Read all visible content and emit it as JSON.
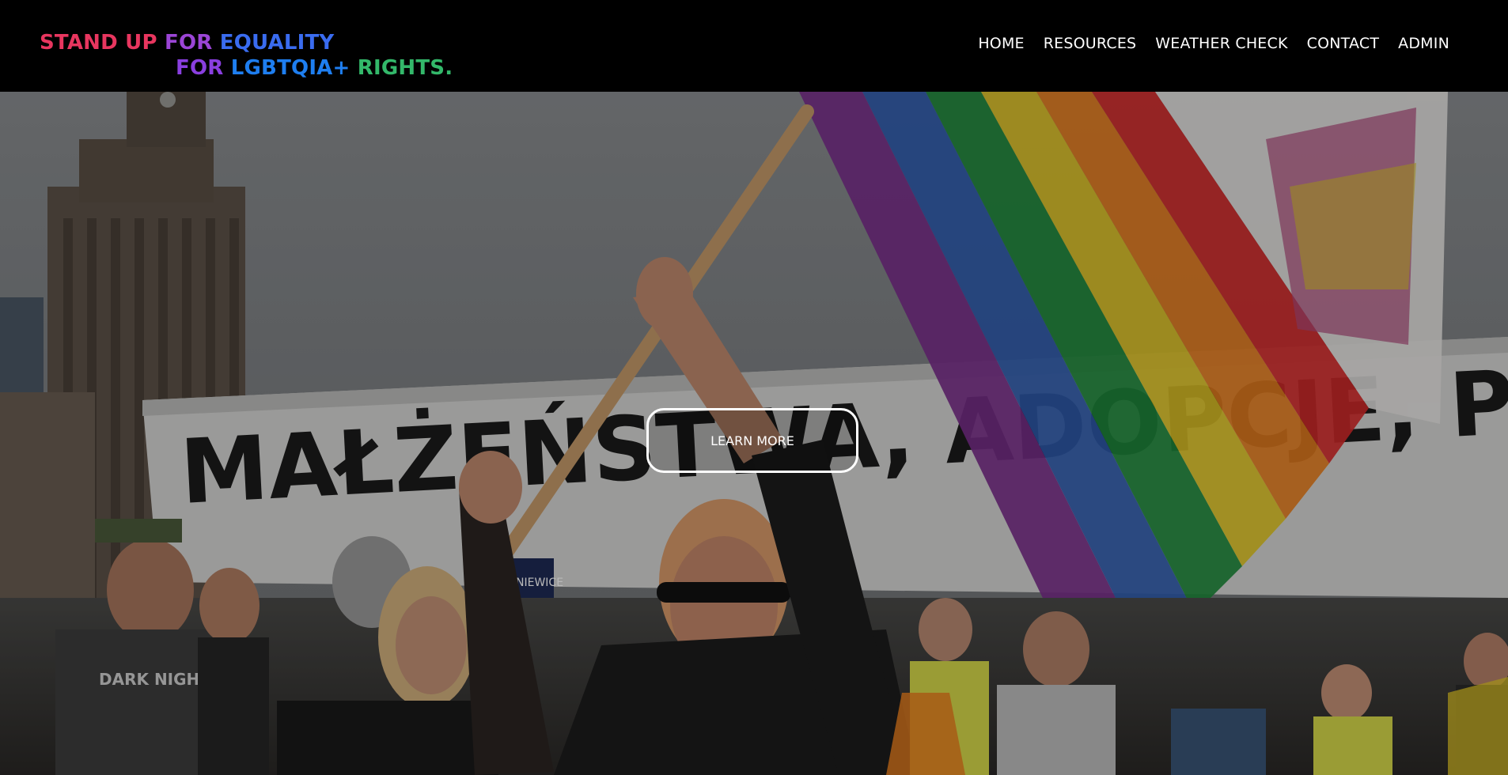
{
  "header": {
    "logo": {
      "line1": [
        {
          "text": "STAND UP ",
          "color": "#e8365f"
        },
        {
          "text": "FOR ",
          "color": "#9b45d6"
        },
        {
          "text": "EQUALITY",
          "color": "#3a6cf0"
        }
      ],
      "line2": [
        {
          "text": "FOR ",
          "color": "#8a3fe0"
        },
        {
          "text": "LGBTQIA+ ",
          "color": "#1e7ef0"
        },
        {
          "text": "RIGHTS.",
          "color": "#33b86a"
        }
      ]
    },
    "nav": [
      {
        "label": "HOME"
      },
      {
        "label": "RESOURCES"
      },
      {
        "label": "WEATHER CHECK"
      },
      {
        "label": "CONTACT"
      },
      {
        "label": "ADMIN"
      }
    ]
  },
  "hero": {
    "banner_text": "MAŁŻEŃSTWA, ADOPCJE, PRAWA LGBT+",
    "street_sign": "NIEWICE",
    "shirt_text": "DARK NIGHT",
    "cta_label": "LEARN MORE",
    "flag_colors": [
      "#7a2f8c",
      "#2f5db0",
      "#1f8a3c",
      "#e1c526",
      "#e97f1f",
      "#d62b2b"
    ]
  }
}
